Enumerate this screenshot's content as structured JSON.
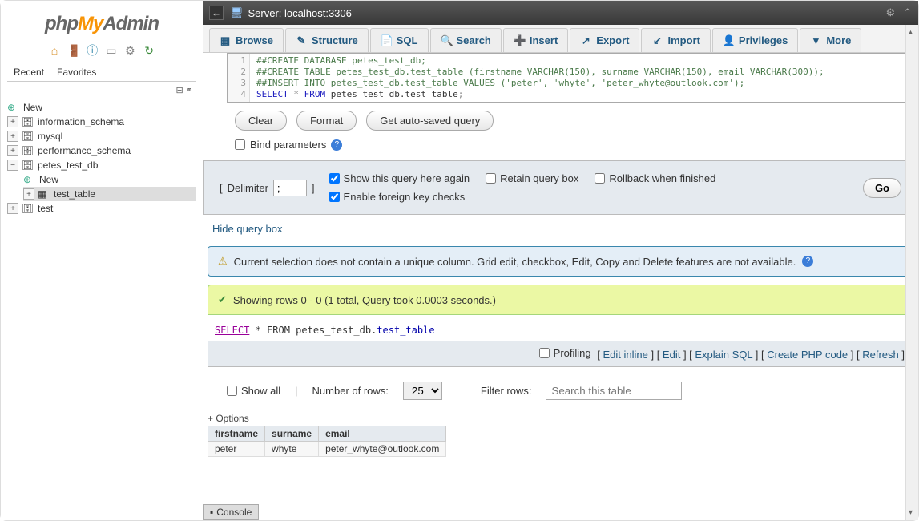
{
  "logo": {
    "php": "php",
    "my": "My",
    "admin": "Admin"
  },
  "sidebar": {
    "recent": "Recent",
    "favorites": "Favorites",
    "tree": {
      "new": "New",
      "information_schema": "information_schema",
      "mysql": "mysql",
      "performance_schema": "performance_schema",
      "petes_test_db": "petes_test_db",
      "petes_new": "New",
      "test_table": "test_table",
      "test": "test"
    }
  },
  "topbar": {
    "server_label": "Server: localhost:3306"
  },
  "tabs": {
    "browse": "Browse",
    "structure": "Structure",
    "sql": "SQL",
    "search": "Search",
    "insert": "Insert",
    "export": "Export",
    "import": "Import",
    "privileges": "Privileges",
    "more": "More"
  },
  "sql": {
    "lines": [
      "1",
      "2",
      "3",
      "4"
    ],
    "l1": "##CREATE DATABASE petes_test_db;",
    "l2": "##CREATE TABLE petes_test_db.test_table (firstname VARCHAR(150), surname VARCHAR(150), email VARCHAR(300));",
    "l3": "##INSERT INTO petes_test_db.test_table VALUES ('peter', 'whyte', 'peter_whyte@outlook.com');",
    "l4_select": "SELECT",
    "l4_star": " * ",
    "l4_from": "FROM",
    "l4_tbl": " petes_test_db.test_table",
    "l4_semi": ";"
  },
  "buttons": {
    "clear": "Clear",
    "format": "Format",
    "auto": "Get auto-saved query"
  },
  "bind": "Bind parameters",
  "panel": {
    "delimiter_label": "Delimiter",
    "delimiter_value": ";",
    "show_again": "Show this query here again",
    "retain": "Retain query box",
    "rollback": "Rollback when finished",
    "fk": "Enable foreign key checks",
    "go": "Go"
  },
  "hide_query": "Hide query box",
  "notice": "Current selection does not contain a unique column. Grid edit, checkbox, Edit, Copy and Delete features are not available.",
  "success": "Showing rows 0 - 0 (1 total, Query took 0.0003 seconds.)",
  "query_display": {
    "select": "SELECT",
    "mid": " * FROM petes_test_db.",
    "table": "test_table"
  },
  "actions": {
    "profiling": "Profiling",
    "edit_inline": "Edit inline",
    "edit": "Edit",
    "explain": "Explain SQL",
    "php": "Create PHP code",
    "refresh": "Refresh"
  },
  "row_opts": {
    "show_all": "Show all",
    "num_rows": "Number of rows:",
    "num_value": "25",
    "filter": "Filter rows:",
    "search_placeholder": "Search this table"
  },
  "plus_options": "+ Options",
  "table": {
    "cols": {
      "firstname": "firstname",
      "surname": "surname",
      "email": "email"
    },
    "row": {
      "firstname": "peter",
      "surname": "whyte",
      "email": "peter_whyte@outlook.com"
    }
  },
  "console": "Console"
}
